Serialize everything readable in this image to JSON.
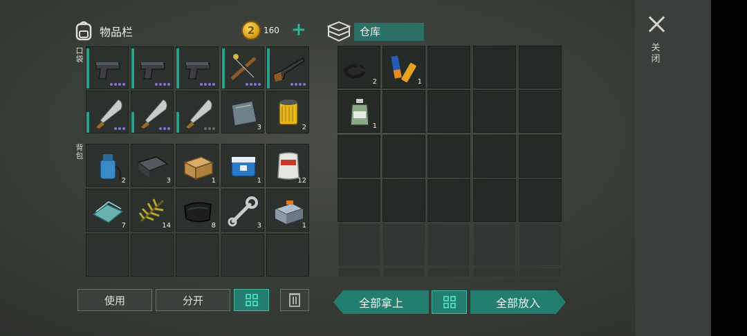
{
  "inventory": {
    "title": "物品栏",
    "coins": "160",
    "coin_glyph": "2",
    "coin_plus": "+",
    "pocket_label": "口袋",
    "backpack_label": "背包",
    "buttons": {
      "use": "使用",
      "split": "分开"
    }
  },
  "pocket_items": [
    {
      "icon": "pistol-icon",
      "count": "",
      "dots": 4
    },
    {
      "icon": "pistol-icon",
      "count": "",
      "dots": 4
    },
    {
      "icon": "pistol-icon",
      "count": "",
      "dots": 4
    },
    {
      "icon": "crossbow-icon",
      "count": "",
      "dots": 4
    },
    {
      "icon": "shotgun-icon",
      "count": "",
      "dots": 4
    },
    {
      "icon": "machete-icon",
      "count": "",
      "dots": 3
    },
    {
      "icon": "machete-icon",
      "count": "",
      "dots": 3
    },
    {
      "icon": "machete-icon",
      "count": "",
      "dots": 3
    },
    {
      "icon": "metal-sheet-icon",
      "count": "3",
      "dots": 0
    },
    {
      "icon": "oil-filter-icon",
      "count": "2",
      "dots": 0
    }
  ],
  "backpack_items": [
    {
      "icon": "pump-icon",
      "count": "2"
    },
    {
      "icon": "battery-box-icon",
      "count": "3"
    },
    {
      "icon": "wooden-crate-icon",
      "count": "1"
    },
    {
      "icon": "cooler-icon",
      "count": "1"
    },
    {
      "icon": "asbestos-bag-icon",
      "count": "12"
    },
    {
      "icon": "glass-icon",
      "count": "7"
    },
    {
      "icon": "pine-branches-icon",
      "count": "14"
    },
    {
      "icon": "rubber-sheet-icon",
      "count": "8"
    },
    {
      "icon": "wrench-icon",
      "count": "3"
    },
    {
      "icon": "toolbox-icon",
      "count": "1"
    }
  ],
  "warehouse": {
    "title": "仓库",
    "buttons": {
      "take_all": "全部拿上",
      "put_all": "全部放入"
    },
    "items": [
      {
        "icon": "gaskets-icon",
        "count": "2"
      },
      {
        "icon": "batteries-icon",
        "count": "1"
      },
      {
        "icon": "chemical-bottle-icon",
        "count": "1"
      }
    ]
  },
  "close_label": "关闭",
  "colors": {
    "accent": "#2fb59a",
    "teal_button": "#237e70",
    "rarity_purple": "#8a6ee0"
  }
}
